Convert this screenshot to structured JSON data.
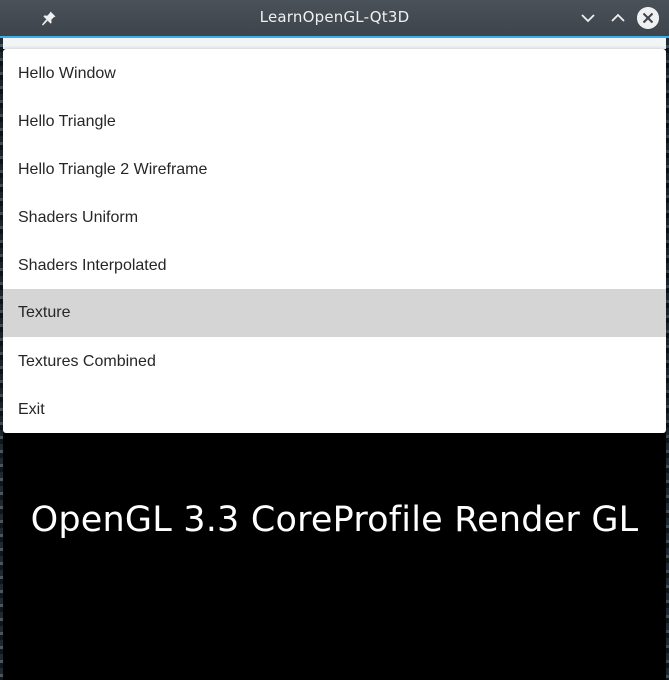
{
  "window": {
    "title": "LearnOpenGL-Qt3D",
    "icons": {
      "pin": "pin-icon",
      "minimize": "chevron-down-icon",
      "maximize": "chevron-up-icon",
      "close": "close-icon"
    },
    "accent_color": "#3daee9"
  },
  "menu": {
    "items": [
      {
        "label": "Hello Window"
      },
      {
        "label": "Hello Triangle"
      },
      {
        "label": "Hello Triangle 2 Wireframe"
      },
      {
        "label": "Shaders Uniform"
      },
      {
        "label": "Shaders Interpolated"
      },
      {
        "label": "Texture",
        "highlighted": true
      },
      {
        "label": "Textures Combined"
      },
      {
        "label": "Exit"
      }
    ],
    "highlight_color": "#d5d5d5"
  },
  "render": {
    "text": "OpenGL 3.3 CoreProfile Render GL"
  }
}
